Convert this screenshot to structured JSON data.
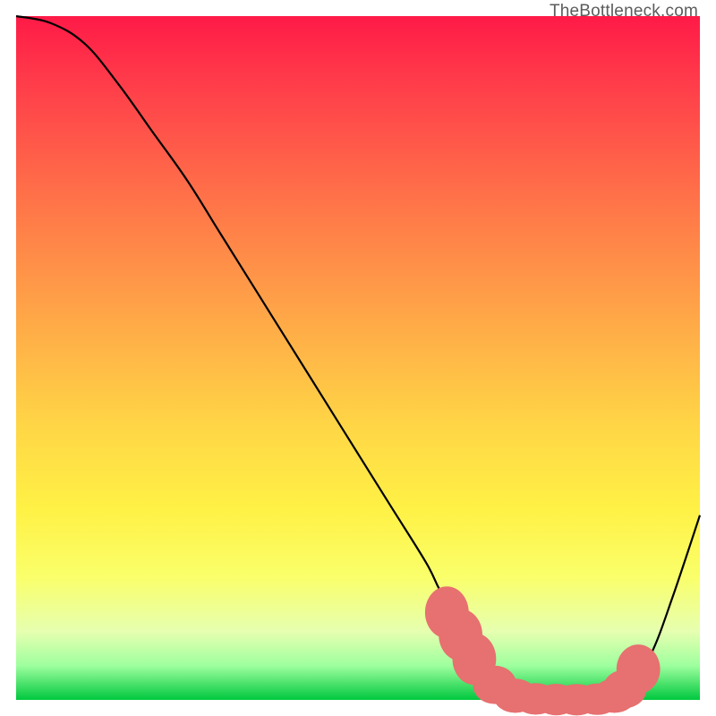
{
  "attribution": "TheBottleneck.com",
  "chart_data": {
    "type": "line",
    "title": "",
    "xlabel": "",
    "ylabel": "",
    "xlim": [
      0,
      100
    ],
    "ylim": [
      0,
      100
    ],
    "background_gradient_stops": [
      {
        "pos": 0,
        "color": "#ff1a47"
      },
      {
        "pos": 10,
        "color": "#ff3d4a"
      },
      {
        "pos": 24,
        "color": "#ff6a49"
      },
      {
        "pos": 36,
        "color": "#ff8f48"
      },
      {
        "pos": 48,
        "color": "#ffb347"
      },
      {
        "pos": 60,
        "color": "#ffd646"
      },
      {
        "pos": 72,
        "color": "#fff145"
      },
      {
        "pos": 82,
        "color": "#faff6a"
      },
      {
        "pos": 90,
        "color": "#e6ffb0"
      },
      {
        "pos": 95,
        "color": "#9eff9e"
      },
      {
        "pos": 100,
        "color": "#00c83e"
      }
    ],
    "series": [
      {
        "name": "curve",
        "color": "#000000",
        "x": [
          0,
          5,
          10,
          15,
          20,
          25,
          30,
          35,
          40,
          45,
          50,
          55,
          60,
          62,
          65,
          68,
          70,
          72,
          75,
          78,
          80,
          82,
          85,
          88,
          90,
          93,
          96,
          100
        ],
        "y": [
          100,
          99,
          96,
          90,
          83,
          76,
          68,
          60,
          52,
          44,
          36,
          28,
          20,
          16,
          11,
          6,
          3,
          1.5,
          0.6,
          0.2,
          0.05,
          0.02,
          0.02,
          0.2,
          2,
          7,
          15,
          27
        ]
      }
    ],
    "markers": {
      "name": "optimal-range-dots",
      "color": "#e77070",
      "points": [
        {
          "x": 63,
          "y": 12.8,
          "rx": 3.2,
          "ry": 3.8
        },
        {
          "x": 65,
          "y": 9.5,
          "rx": 3.2,
          "ry": 3.8
        },
        {
          "x": 67,
          "y": 6.0,
          "rx": 3.2,
          "ry": 3.8
        },
        {
          "x": 70,
          "y": 2.2,
          "rx": 3.2,
          "ry": 2.8
        },
        {
          "x": 73,
          "y": 0.6,
          "rx": 3.2,
          "ry": 2.5
        },
        {
          "x": 76,
          "y": 0.15,
          "rx": 3.2,
          "ry": 2.3
        },
        {
          "x": 79,
          "y": 0.05,
          "rx": 3.2,
          "ry": 2.3
        },
        {
          "x": 82,
          "y": 0.02,
          "rx": 3.2,
          "ry": 2.3
        },
        {
          "x": 85,
          "y": 0.1,
          "rx": 3.2,
          "ry": 2.3
        },
        {
          "x": 87.5,
          "y": 0.6,
          "rx": 3.2,
          "ry": 2.5
        },
        {
          "x": 89,
          "y": 1.6,
          "rx": 3.2,
          "ry": 2.8
        },
        {
          "x": 91,
          "y": 4.5,
          "rx": 3.2,
          "ry": 3.6
        }
      ]
    }
  }
}
